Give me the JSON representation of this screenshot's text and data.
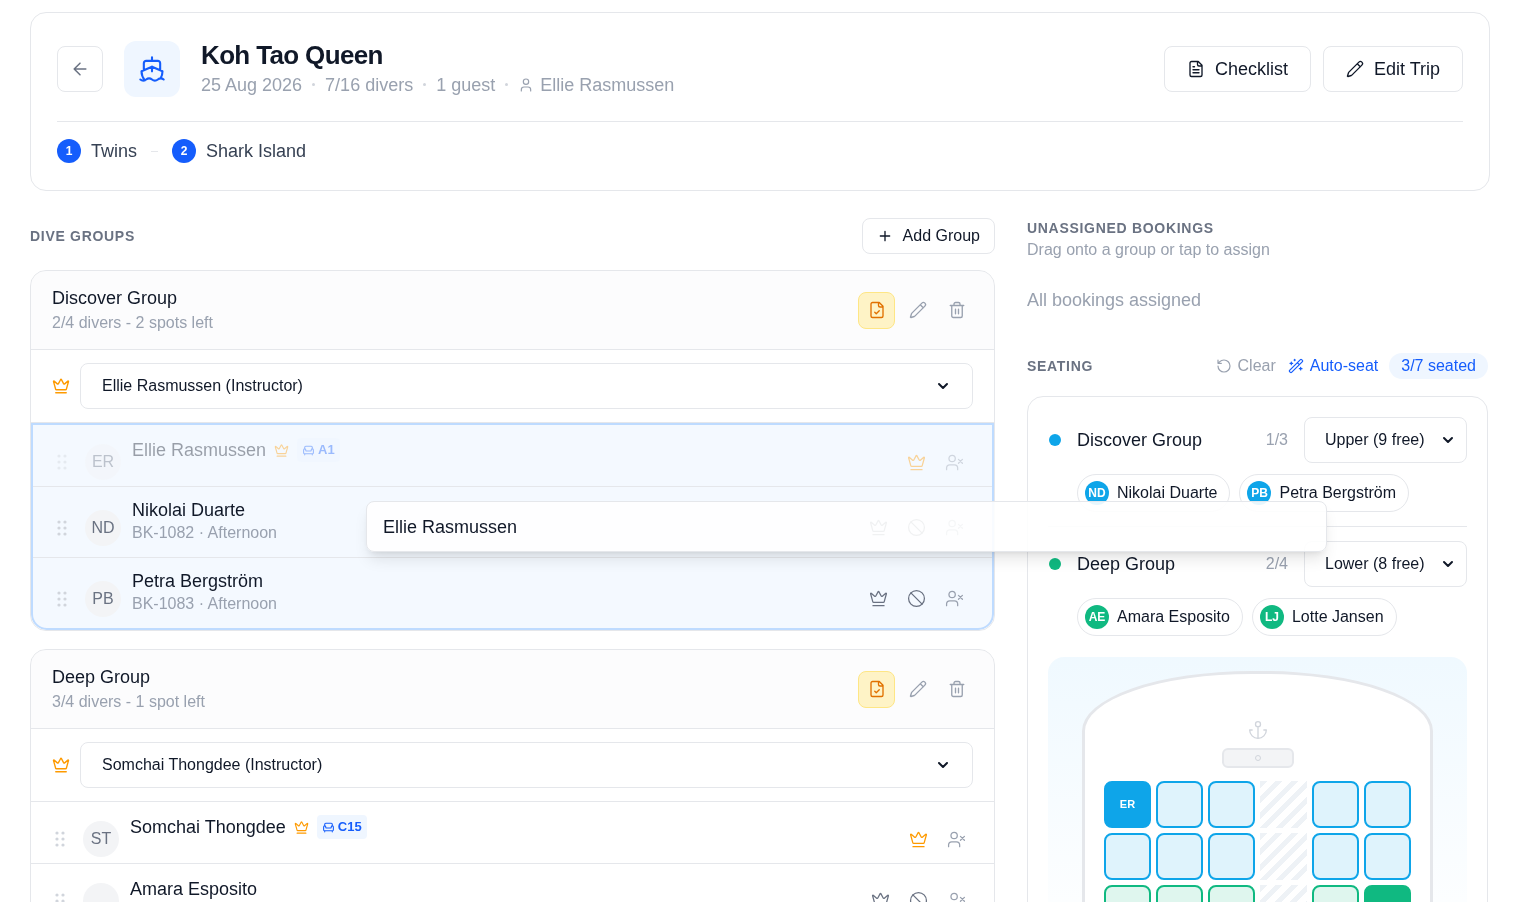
{
  "header": {
    "title": "Koh Tao Queen",
    "meta": [
      "25 Aug 2026",
      "7/16 divers",
      "1 guest"
    ],
    "captain": "Ellie Rasmussen",
    "buttons": [
      {
        "label": "Checklist",
        "kind": "checklist"
      },
      {
        "label": "Edit Trip",
        "kind": "edit"
      }
    ]
  },
  "sites": [
    {
      "number": "1",
      "name": "Twins"
    },
    {
      "number": "2",
      "name": "Shark Island"
    }
  ],
  "dive_groups": {
    "heading": "DIVE GROUPS",
    "add_button": "Add Group",
    "groups": [
      {
        "name": "Discover Group",
        "summary": "2/4 divers - 2 spots left",
        "instructor": "Ellie Rasmussen (Instructor)",
        "drop_target": true,
        "members": [
          {
            "initials": "ER",
            "name": "Ellie Rasmussen",
            "leader": true,
            "seat": "A1",
            "dragging": true
          },
          {
            "initials": "ND",
            "name": "Nikolai Duarte",
            "booking": "BK-1082 · Afternoon",
            "leader": false,
            "dragging": false
          },
          {
            "initials": "PB",
            "name": "Petra Bergström",
            "booking": "BK-1083 · Afternoon",
            "leader": false,
            "dragging": false
          }
        ]
      },
      {
        "name": "Deep Group",
        "summary": "3/4 divers - 1 spot left",
        "instructor": "Somchai Thongdee (Instructor)",
        "drop_target": false,
        "members": [
          {
            "initials": "ST",
            "name": "Somchai Thongdee",
            "leader": true,
            "seat": "C15",
            "dragging": false
          },
          {
            "name": "Amara Esposito",
            "leader": false,
            "dragging": false
          }
        ]
      }
    ]
  },
  "unassigned": {
    "heading": "UNASSIGNED BOOKINGS",
    "hint": "Drag onto a group or tap to assign",
    "empty_text": "All bookings assigned"
  },
  "seating": {
    "heading": "SEATING",
    "clear": "Clear",
    "auto_seat": "Auto-seat",
    "seated": "3/7 seated",
    "groups": [
      {
        "name": "Discover Group",
        "color": "#0ea5e9",
        "count": "1/3",
        "deck": "Upper (9 free)",
        "members": [
          {
            "initials": "ND",
            "name": "Nikolai Duarte"
          },
          {
            "initials": "PB",
            "name": "Petra Bergström"
          }
        ]
      },
      {
        "name": "Deep Group",
        "color": "#10b981",
        "count": "2/4",
        "deck": "Lower (8 free)",
        "members": [
          {
            "initials": "AE",
            "name": "Amara Esposito"
          },
          {
            "initials": "LJ",
            "name": "Lotte Jansen"
          }
        ]
      }
    ],
    "seat_map": {
      "rows": [
        [
          {
            "kind": "seat",
            "color": "#0ea5e9",
            "occupied": true,
            "label": "ER"
          },
          {
            "kind": "seat",
            "color": "#0ea5e9",
            "occupied": false
          },
          {
            "kind": "seat",
            "color": "#0ea5e9",
            "occupied": false
          },
          {
            "kind": "aisle"
          },
          {
            "kind": "seat",
            "color": "#0ea5e9",
            "occupied": false
          },
          {
            "kind": "seat",
            "color": "#0ea5e9",
            "occupied": false
          }
        ],
        [
          {
            "kind": "seat",
            "color": "#0ea5e9",
            "occupied": false
          },
          {
            "kind": "seat",
            "color": "#0ea5e9",
            "occupied": false
          },
          {
            "kind": "seat",
            "color": "#0ea5e9",
            "occupied": false
          },
          {
            "kind": "aisle"
          },
          {
            "kind": "seat",
            "color": "#0ea5e9",
            "occupied": false
          },
          {
            "kind": "seat",
            "color": "#0ea5e9",
            "occupied": false
          }
        ],
        [
          {
            "kind": "seat",
            "color": "#10b981",
            "occupied": false
          },
          {
            "kind": "seat",
            "color": "#10b981",
            "occupied": false
          },
          {
            "kind": "seat",
            "color": "#10b981",
            "occupied": false
          },
          {
            "kind": "aisle"
          },
          {
            "kind": "seat",
            "color": "#10b981",
            "occupied": false
          },
          {
            "kind": "seat",
            "color": "#10b981",
            "occupied": true
          }
        ]
      ]
    }
  },
  "drag_preview": {
    "label": "Ellie Rasmussen"
  }
}
